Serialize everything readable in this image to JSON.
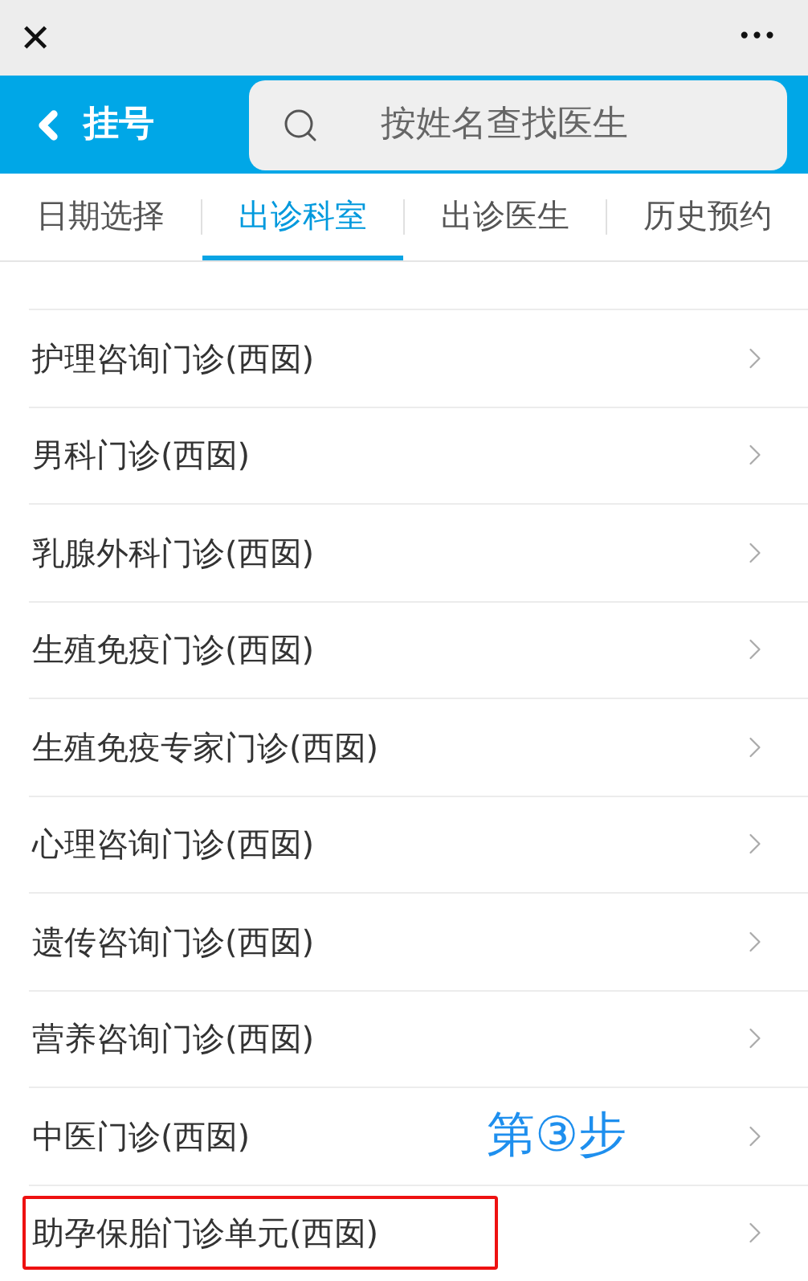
{
  "top_bar": {
    "close": "✕",
    "more": "•••"
  },
  "header": {
    "back_label": "挂号",
    "search": {
      "placeholder": "按姓名查找医生"
    }
  },
  "tabs": [
    {
      "label": "日期选择",
      "selected": false
    },
    {
      "label": "出诊科室",
      "selected": true
    },
    {
      "label": "出诊医生",
      "selected": false
    },
    {
      "label": "历史预约",
      "selected": false
    }
  ],
  "departments": [
    {
      "name": "护理咨询门诊(西囡)",
      "highlighted": false
    },
    {
      "name": "男科门诊(西囡)",
      "highlighted": false
    },
    {
      "name": "乳腺外科门诊(西囡)",
      "highlighted": false
    },
    {
      "name": "生殖免疫门诊(西囡)",
      "highlighted": false
    },
    {
      "name": "生殖免疫专家门诊(西囡)",
      "highlighted": false
    },
    {
      "name": "心理咨询门诊(西囡)",
      "highlighted": false
    },
    {
      "name": "遗传咨询门诊(西囡)",
      "highlighted": false
    },
    {
      "name": "营养咨询门诊(西囡)",
      "highlighted": false
    },
    {
      "name": "中医门诊(西囡)",
      "highlighted": false,
      "annotation": "第③步"
    },
    {
      "name": "助孕保胎门诊单元(西囡)",
      "highlighted": true
    }
  ]
}
